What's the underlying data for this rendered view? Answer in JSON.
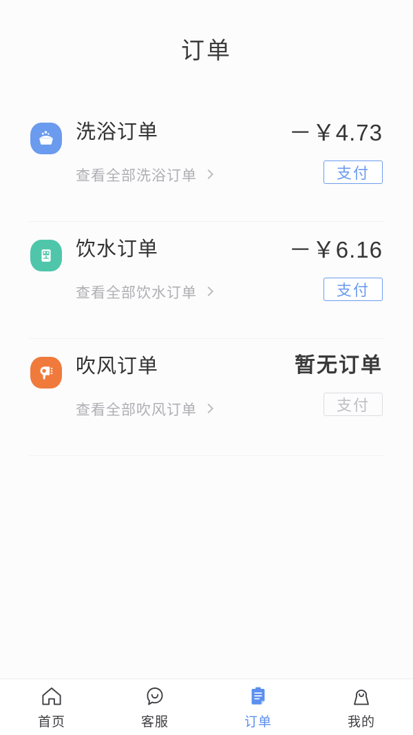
{
  "header": {
    "title": "订单"
  },
  "theme": {
    "accent": "#6B9BEE",
    "tab_active": "#5B8FF0",
    "page_bg": "#FCFCFD",
    "divider": "#F1F1F4",
    "disabled_border": "#DCDCE0",
    "disabled_text": "#BEBEC3"
  },
  "orders": [
    {
      "icon_name": "bathtub-icon",
      "icon_bg": "#6B9BEE",
      "title": "洗浴订单",
      "subtitle": "查看全部洗浴订单",
      "amount": "－￥4.73",
      "has_order": true,
      "pay_label": "支付"
    },
    {
      "icon_name": "water-dispenser-icon",
      "icon_bg": "#4FC6AA",
      "title": "饮水订单",
      "subtitle": "查看全部饮水订单",
      "amount": "－￥6.16",
      "has_order": true,
      "pay_label": "支付"
    },
    {
      "icon_name": "hairdryer-icon",
      "icon_bg": "#F07A3C",
      "title": "吹风订单",
      "subtitle": "查看全部吹风订单",
      "amount": "暂无订单",
      "has_order": false,
      "pay_label": "支付"
    }
  ],
  "tabbar": {
    "items": [
      {
        "icon_name": "home-icon",
        "label": "首页",
        "active": false
      },
      {
        "icon_name": "support-chat-icon",
        "label": "客服",
        "active": false
      },
      {
        "icon_name": "clipboard-icon",
        "label": "订单",
        "active": true
      },
      {
        "icon_name": "person-icon",
        "label": "我的",
        "active": false
      }
    ]
  }
}
